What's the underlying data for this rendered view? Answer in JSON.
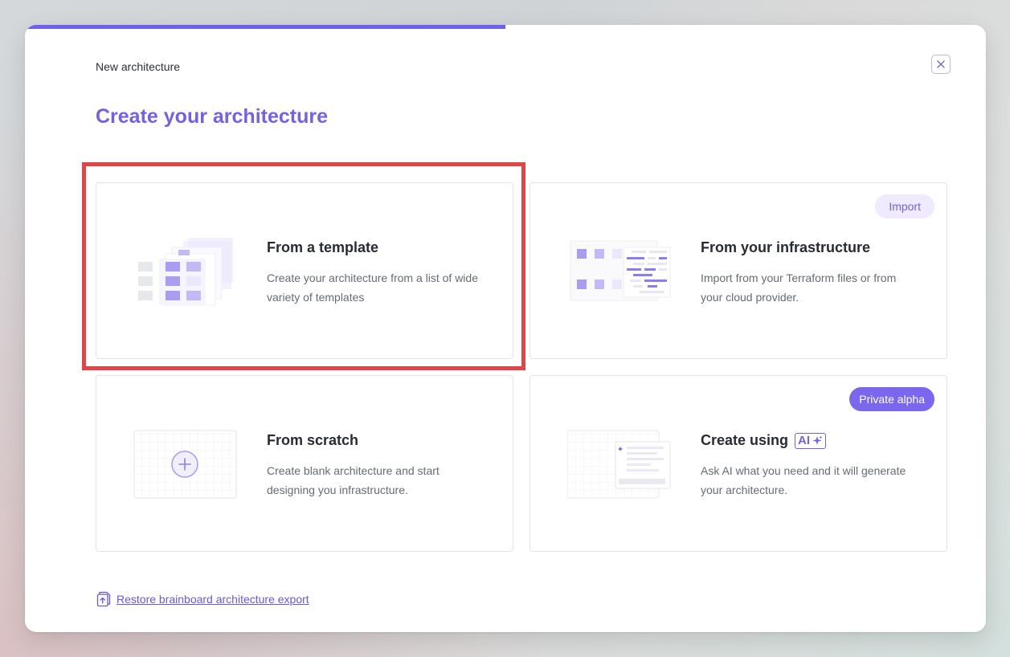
{
  "dialog": {
    "breadcrumb": "New architecture",
    "title": "Create your architecture",
    "close_icon": "close-icon",
    "progress": 0.5
  },
  "options": [
    {
      "title": "From a template",
      "description": "Create your architecture from a list of wide variety of templates",
      "icon": "template-illustration"
    },
    {
      "title": "From your infrastructure",
      "description": "Import from your Terraform files or from your cloud provider.",
      "badge": "Import",
      "icon": "infrastructure-illustration"
    },
    {
      "title": "From scratch",
      "description": "Create blank architecture and start designing you infrastructure.",
      "icon": "plus-circle-icon"
    },
    {
      "title": "Create using",
      "ai_label": "AI",
      "description": "Ask AI what you need and it will generate your architecture.",
      "badge": "Private alpha",
      "icon": "ai-sparkle-icon"
    }
  ],
  "footer": {
    "restore_label": "Restore brainboard architecture export",
    "restore_icon": "file-upload-icon"
  },
  "colors": {
    "accent": "#7560ea",
    "highlight": "#e04646"
  }
}
